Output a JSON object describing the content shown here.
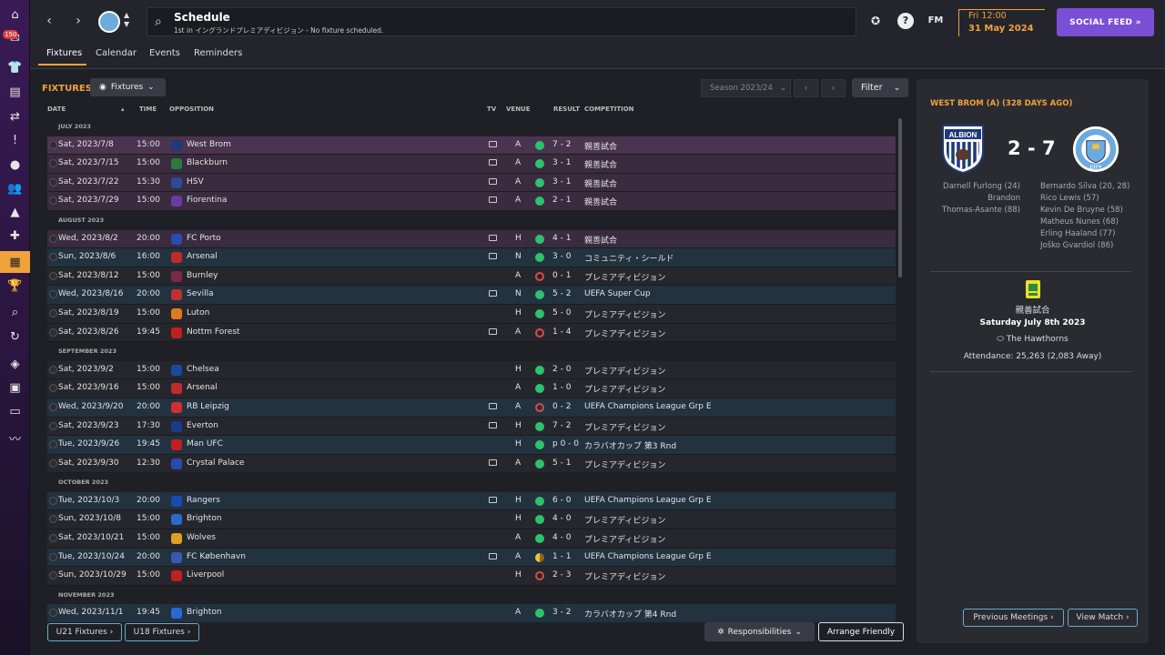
{
  "sidebar": {
    "badge": "150",
    "items": [
      "home-icon",
      "inbox-icon",
      "squad-icon",
      "documents-icon",
      "transfers-icon",
      "reports-icon",
      "ball-icon",
      "staff-icon",
      "training-icon",
      "medical-icon",
      "schedule-icon",
      "competitions-icon",
      "scouting-icon",
      "refresh-icon",
      "club-icon",
      "finance-icon",
      "tickets-icon",
      "analysis-icon"
    ]
  },
  "header": {
    "title": "Schedule",
    "subtitle": "1st in イングランドプレミアディビジョン - No fixture scheduled.",
    "date_day": "Fri 12:00",
    "date_full": "31 May 2024",
    "fm_label": "FM",
    "social_feed": "SOCIAL FEED  »"
  },
  "tabs": [
    "Fixtures",
    "Calendar",
    "Events",
    "Reminders"
  ],
  "toolbar": {
    "title": "FIXTURES",
    "view_dropdown": "Fixtures",
    "season": "Season 2023/24",
    "filter": "Filter"
  },
  "columns": {
    "date": "DATE",
    "time": "TIME",
    "opposition": "OPPOSITION",
    "tv": "TV",
    "venue": "VENUE",
    "result": "RESULT",
    "competition": "COMPETITION"
  },
  "fixtures": [
    {
      "group": "JULY 2023"
    },
    {
      "date": "Sat, 2023/7/8",
      "time": "15:00",
      "opp": "West Brom",
      "badge": "#1e3a7a",
      "tv": true,
      "venue": "A",
      "res": "w",
      "score": "7 - 2",
      "comp": "親善試合",
      "style": "pink sel"
    },
    {
      "date": "Sat, 2023/7/15",
      "time": "15:00",
      "opp": "Blackburn",
      "badge": "#2a7a3a",
      "tv": true,
      "venue": "A",
      "res": "w",
      "score": "3 - 1",
      "comp": "親善試合",
      "style": "pink"
    },
    {
      "date": "Sat, 2023/7/22",
      "time": "15:30",
      "opp": "HSV",
      "badge": "#2a4a9a",
      "tv": true,
      "venue": "A",
      "res": "w",
      "score": "3 - 1",
      "comp": "親善試合",
      "style": "pink"
    },
    {
      "date": "Sat, 2023/7/29",
      "time": "15:00",
      "opp": "Fiorentina",
      "badge": "#6a3aa0",
      "tv": true,
      "venue": "A",
      "res": "w",
      "score": "2 - 1",
      "comp": "親善試合",
      "style": "pink"
    },
    {
      "group": "AUGUST 2023"
    },
    {
      "date": "Wed, 2023/8/2",
      "time": "20:00",
      "opp": "FC Porto",
      "badge": "#2a4ab0",
      "tv": true,
      "venue": "H",
      "res": "w",
      "score": "4 - 1",
      "comp": "親善試合",
      "style": "pink"
    },
    {
      "date": "Sun, 2023/8/6",
      "time": "16:00",
      "opp": "Arsenal",
      "badge": "#c02a2a",
      "tv": true,
      "venue": "N",
      "res": "w",
      "score": "3 - 0",
      "comp": "コミュニティ・シールド",
      "style": "blue"
    },
    {
      "date": "Sat, 2023/8/12",
      "time": "15:00",
      "opp": "Burnley",
      "badge": "#7a2a4a",
      "tv": false,
      "venue": "A",
      "res": "l",
      "score": "0 - 1",
      "comp": "プレミアディビジョン",
      "style": "dark"
    },
    {
      "date": "Wed, 2023/8/16",
      "time": "20:00",
      "opp": "Sevilla",
      "badge": "#c03030",
      "tv": true,
      "venue": "N",
      "res": "w",
      "score": "5 - 2",
      "comp": "UEFA Super Cup",
      "style": "blue"
    },
    {
      "date": "Sat, 2023/8/19",
      "time": "15:00",
      "opp": "Luton",
      "badge": "#e07a20",
      "tv": false,
      "venue": "H",
      "res": "w",
      "score": "5 - 0",
      "comp": "プレミアディビジョン",
      "style": "dark"
    },
    {
      "date": "Sat, 2023/8/26",
      "time": "19:45",
      "opp": "Nottm Forest",
      "badge": "#c02020",
      "tv": true,
      "venue": "A",
      "res": "l",
      "score": "1 - 4",
      "comp": "プレミアディビジョン",
      "style": "dark"
    },
    {
      "group": "SEPTEMBER 2023"
    },
    {
      "date": "Sat, 2023/9/2",
      "time": "15:00",
      "opp": "Chelsea",
      "badge": "#1a4aa0",
      "tv": false,
      "venue": "H",
      "res": "w",
      "score": "2 - 0",
      "comp": "プレミアディビジョン",
      "style": "dark"
    },
    {
      "date": "Sat, 2023/9/16",
      "time": "15:00",
      "opp": "Arsenal",
      "badge": "#c02a2a",
      "tv": false,
      "venue": "A",
      "res": "w",
      "score": "1 - 0",
      "comp": "プレミアディビジョン",
      "style": "dark"
    },
    {
      "date": "Wed, 2023/9/20",
      "time": "20:00",
      "opp": "RB Leipzig",
      "badge": "#d03030",
      "tv": true,
      "venue": "A",
      "res": "l",
      "score": "0 - 2",
      "comp": "UEFA Champions League Grp E",
      "style": "blue"
    },
    {
      "date": "Sat, 2023/9/23",
      "time": "17:30",
      "opp": "Everton",
      "badge": "#1a3a90",
      "tv": true,
      "venue": "H",
      "res": "w",
      "score": "7 - 2",
      "comp": "プレミアディビジョン",
      "style": "dark"
    },
    {
      "date": "Tue, 2023/9/26",
      "time": "19:45",
      "opp": "Man UFC",
      "badge": "#c02020",
      "tv": false,
      "venue": "H",
      "res": "w",
      "score": "p 0 - 0",
      "comp": "カラバオカップ 第3 Rnd",
      "style": "blue"
    },
    {
      "date": "Sat, 2023/9/30",
      "time": "12:30",
      "opp": "Crystal Palace",
      "badge": "#2a4ab0",
      "tv": true,
      "venue": "A",
      "res": "w",
      "score": "5 - 1",
      "comp": "プレミアディビジョン",
      "style": "dark"
    },
    {
      "group": "OCTOBER 2023"
    },
    {
      "date": "Tue, 2023/10/3",
      "time": "20:00",
      "opp": "Rangers",
      "badge": "#1a4ab0",
      "tv": true,
      "venue": "H",
      "res": "w",
      "score": "6 - 0",
      "comp": "UEFA Champions League Grp E",
      "style": "blue"
    },
    {
      "date": "Sun, 2023/10/8",
      "time": "15:00",
      "opp": "Brighton",
      "badge": "#2a6ad0",
      "tv": false,
      "venue": "H",
      "res": "w",
      "score": "4 - 0",
      "comp": "プレミアディビジョン",
      "style": "dark"
    },
    {
      "date": "Sat, 2023/10/21",
      "time": "15:00",
      "opp": "Wolves",
      "badge": "#e0a020",
      "tv": false,
      "venue": "A",
      "res": "w",
      "score": "4 - 0",
      "comp": "プレミアディビジョン",
      "style": "dark"
    },
    {
      "date": "Tue, 2023/10/24",
      "time": "20:00",
      "opp": "FC København",
      "badge": "#3a5ab0",
      "tv": true,
      "venue": "A",
      "res": "d",
      "score": "1 - 1",
      "comp": "UEFA Champions League Grp E",
      "style": "blue"
    },
    {
      "date": "Sun, 2023/10/29",
      "time": "15:00",
      "opp": "Liverpool",
      "badge": "#c02020",
      "tv": false,
      "venue": "H",
      "res": "l",
      "score": "2 - 3",
      "comp": "プレミアディビジョン",
      "style": "dark"
    },
    {
      "group": "NOVEMBER 2023"
    },
    {
      "date": "Wed, 2023/11/1",
      "time": "19:45",
      "opp": "Brighton",
      "badge": "#2a6ad0",
      "tv": false,
      "venue": "A",
      "res": "w",
      "score": "3 - 2",
      "comp": "カラバオカップ 第4 Rnd",
      "style": "blue"
    }
  ],
  "footer": {
    "u21": "U21 Fixtures ›",
    "u18": "U18 Fixtures ›",
    "responsibilities": "Responsibilities",
    "arrange": "Arrange Friendly"
  },
  "panel": {
    "title": "WEST BROM (A) (328 DAYS AGO)",
    "score": "2 - 7",
    "home_crest_text": "ALBION",
    "away_crest_text": "CITY",
    "home_scorers": [
      "Darnell Furlong (24)",
      "Brandon",
      "Thomas-Asante (88)"
    ],
    "away_scorers": [
      "Bernardo Silva (20, 28)",
      "Rico Lewis (57)",
      "Kevin De Bruyne (58)",
      "Matheus Nunes (68)",
      "Erling Haaland (77)",
      "Joško Gvardiol (86)"
    ],
    "competition": "親善試合",
    "match_date": "Saturday July 8th 2023",
    "stadium": "The Hawthorns",
    "attendance": "Attendance: 25,263 (2,083 Away)",
    "prev_meetings": "Previous Meetings ›",
    "view_match": "View Match ›"
  },
  "colors": {
    "accent": "#f0a23b",
    "social": "#7a4fd6",
    "win": "#2bc36b",
    "loss": "#e04848"
  }
}
